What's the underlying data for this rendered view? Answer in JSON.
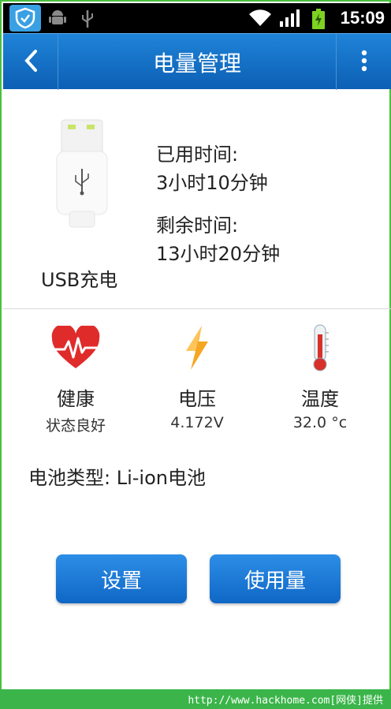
{
  "status_bar": {
    "time": "15:09",
    "icons": [
      "app-shield-icon",
      "android-icon",
      "usb-icon",
      "wifi-icon",
      "signal-icon",
      "battery-charging-icon"
    ]
  },
  "header": {
    "title": "电量管理",
    "back_icon": "chevron-left-icon",
    "menu_icon": "more-vertical-icon"
  },
  "charging": {
    "mode": "USB充电",
    "used_label": "已用时间:",
    "used_value": "3小时10分钟",
    "remaining_label": "剩余时间:",
    "remaining_value": "13小时20分钟"
  },
  "stats": {
    "health": {
      "title": "健康",
      "value": "状态良好",
      "icon": "heart-pulse-icon"
    },
    "voltage": {
      "title": "电压",
      "value": "4.172V",
      "icon": "lightning-icon"
    },
    "temperature": {
      "title": "温度",
      "value": "32.0 °c",
      "icon": "thermometer-icon"
    }
  },
  "battery": {
    "type_text": "电池类型:  Li-ion电池"
  },
  "buttons": {
    "settings": "设置",
    "usage": "使用量"
  },
  "footer": {
    "text": "http://www.hackhome.com[网侠]提供"
  },
  "colors": {
    "header_blue": "#1a76cc",
    "button_blue": "#1f7fdb",
    "frame_green": "#4bbf3f",
    "heart_red": "#e02b2b",
    "bolt_orange": "#f5a623"
  }
}
